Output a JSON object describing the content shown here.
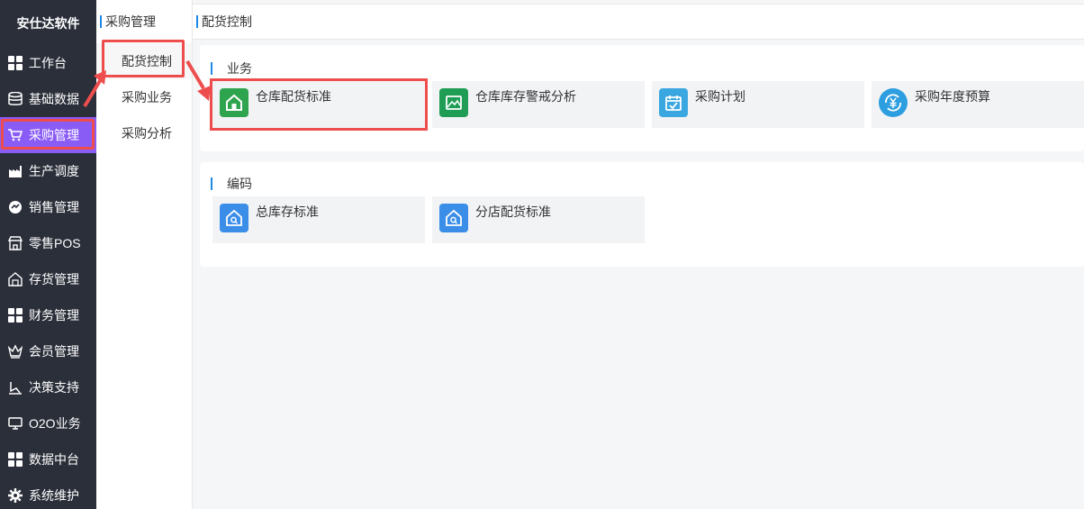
{
  "brand": "安仕达软件",
  "sidebar": {
    "items": [
      {
        "label": "工作台",
        "icon": "grid-icon"
      },
      {
        "label": "基础数据",
        "icon": "database-icon"
      },
      {
        "label": "采购管理",
        "icon": "cart-icon",
        "active": true
      },
      {
        "label": "生产调度",
        "icon": "factory-icon"
      },
      {
        "label": "销售管理",
        "icon": "sales-icon"
      },
      {
        "label": "零售POS",
        "icon": "store-icon"
      },
      {
        "label": "存货管理",
        "icon": "warehouse-icon"
      },
      {
        "label": "财务管理",
        "icon": "grid-icon"
      },
      {
        "label": "会员管理",
        "icon": "crown-icon"
      },
      {
        "label": "决策支持",
        "icon": "decision-icon"
      },
      {
        "label": "O2O业务",
        "icon": "monitor-icon"
      },
      {
        "label": "数据中台",
        "icon": "grid-icon"
      },
      {
        "label": "系统维护",
        "icon": "gear-icon"
      }
    ]
  },
  "submenu": {
    "title": "采购管理",
    "items": [
      {
        "label": "配货控制",
        "active": true
      },
      {
        "label": "采购业务"
      },
      {
        "label": "采购分析"
      }
    ]
  },
  "header": {
    "breadcrumb": "配货控制"
  },
  "sections": [
    {
      "title": "业务",
      "tiles": [
        {
          "label": "仓库配货标准",
          "icon": "home-icon",
          "color": "#2ea44f"
        },
        {
          "label": "仓库库存警戒分析",
          "icon": "picture-icon",
          "color": "#1f9d55"
        },
        {
          "label": "采购计划",
          "icon": "calendar-check-icon",
          "color": "#3ba7e0"
        },
        {
          "label": "采购年度预算",
          "icon": "yen-cycle-icon",
          "color": "#2d9ee0"
        }
      ]
    },
    {
      "title": "编码",
      "tiles": [
        {
          "label": "总库存标准",
          "icon": "house-search-icon",
          "color": "#3b8ee8"
        },
        {
          "label": "分店配货标准",
          "icon": "house-search-icon",
          "color": "#3b8ee8"
        }
      ]
    }
  ],
  "colors": {
    "sidebar_bg": "#2b2f3a",
    "active_purple": "#8a5cf6",
    "highlight_red": "#ee4d4d",
    "accent_blue": "#1e88e5"
  }
}
